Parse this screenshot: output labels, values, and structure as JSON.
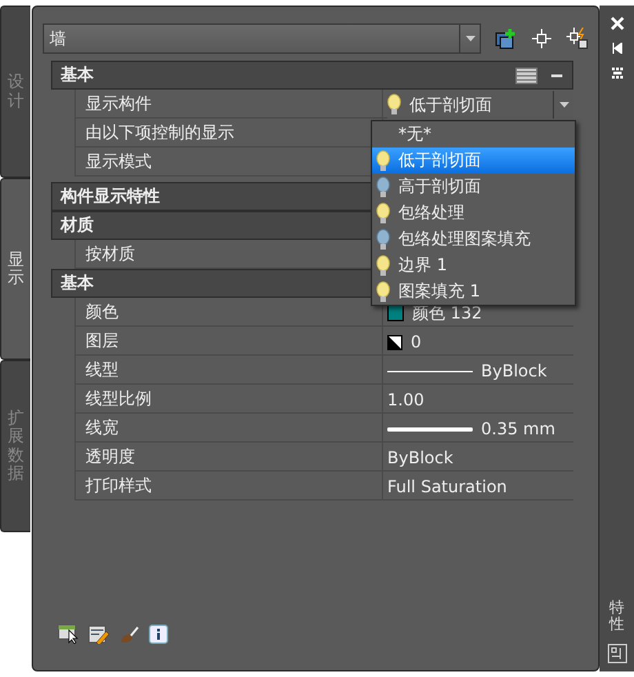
{
  "side_tabs": [
    {
      "label": "设计",
      "selected": false
    },
    {
      "label": "显示",
      "selected": true
    },
    {
      "label": "扩展数据",
      "selected": false
    }
  ],
  "object_selector": {
    "value": "墙"
  },
  "palette_title": "特性",
  "rows": [
    {
      "kind": "header",
      "label": "基本",
      "tools": true
    },
    {
      "kind": "property",
      "label": "显示构件",
      "value": {
        "kind": "dropdown",
        "text": "低于剖切面",
        "on": true
      }
    },
    {
      "kind": "property",
      "label": "由以下项控制的显示"
    },
    {
      "kind": "property",
      "label": "显示模式"
    },
    {
      "kind": "gap"
    },
    {
      "kind": "header",
      "label": "构件显示特性"
    },
    {
      "kind": "header",
      "label": "材质"
    },
    {
      "kind": "property",
      "label": "按材质"
    },
    {
      "kind": "header",
      "label": "基本"
    },
    {
      "kind": "property",
      "label": "颜色",
      "value": {
        "kind": "color",
        "text": "颜色 132",
        "color": "#00807f"
      }
    },
    {
      "kind": "property",
      "label": "图层",
      "value": {
        "kind": "layer",
        "text": "0"
      }
    },
    {
      "kind": "property",
      "label": "线型",
      "value": {
        "kind": "linetype",
        "text": "ByBlock"
      }
    },
    {
      "kind": "property",
      "label": "线型比例",
      "value": {
        "kind": "text",
        "text": "1.00"
      }
    },
    {
      "kind": "property",
      "label": "线宽",
      "value": {
        "kind": "lineweight",
        "text": "0.35 mm"
      }
    },
    {
      "kind": "property",
      "label": "透明度",
      "value": {
        "kind": "text",
        "text": "ByBlock"
      }
    },
    {
      "kind": "property",
      "label": "打印样式",
      "value": {
        "kind": "text",
        "text": "Full Saturation"
      }
    }
  ],
  "dropdown_list": [
    {
      "label": "*无*",
      "selected": false
    },
    {
      "label": "低于剖切面",
      "on": true,
      "selected": true
    },
    {
      "label": "高于剖切面",
      "on": false,
      "selected": false
    },
    {
      "label": "包络处理",
      "on": true,
      "selected": false
    },
    {
      "label": "包络处理图案填充",
      "on": false,
      "selected": false
    },
    {
      "label": "边界 1",
      "on": true,
      "selected": false
    },
    {
      "label": "图案填充 1",
      "on": true,
      "selected": false
    }
  ]
}
